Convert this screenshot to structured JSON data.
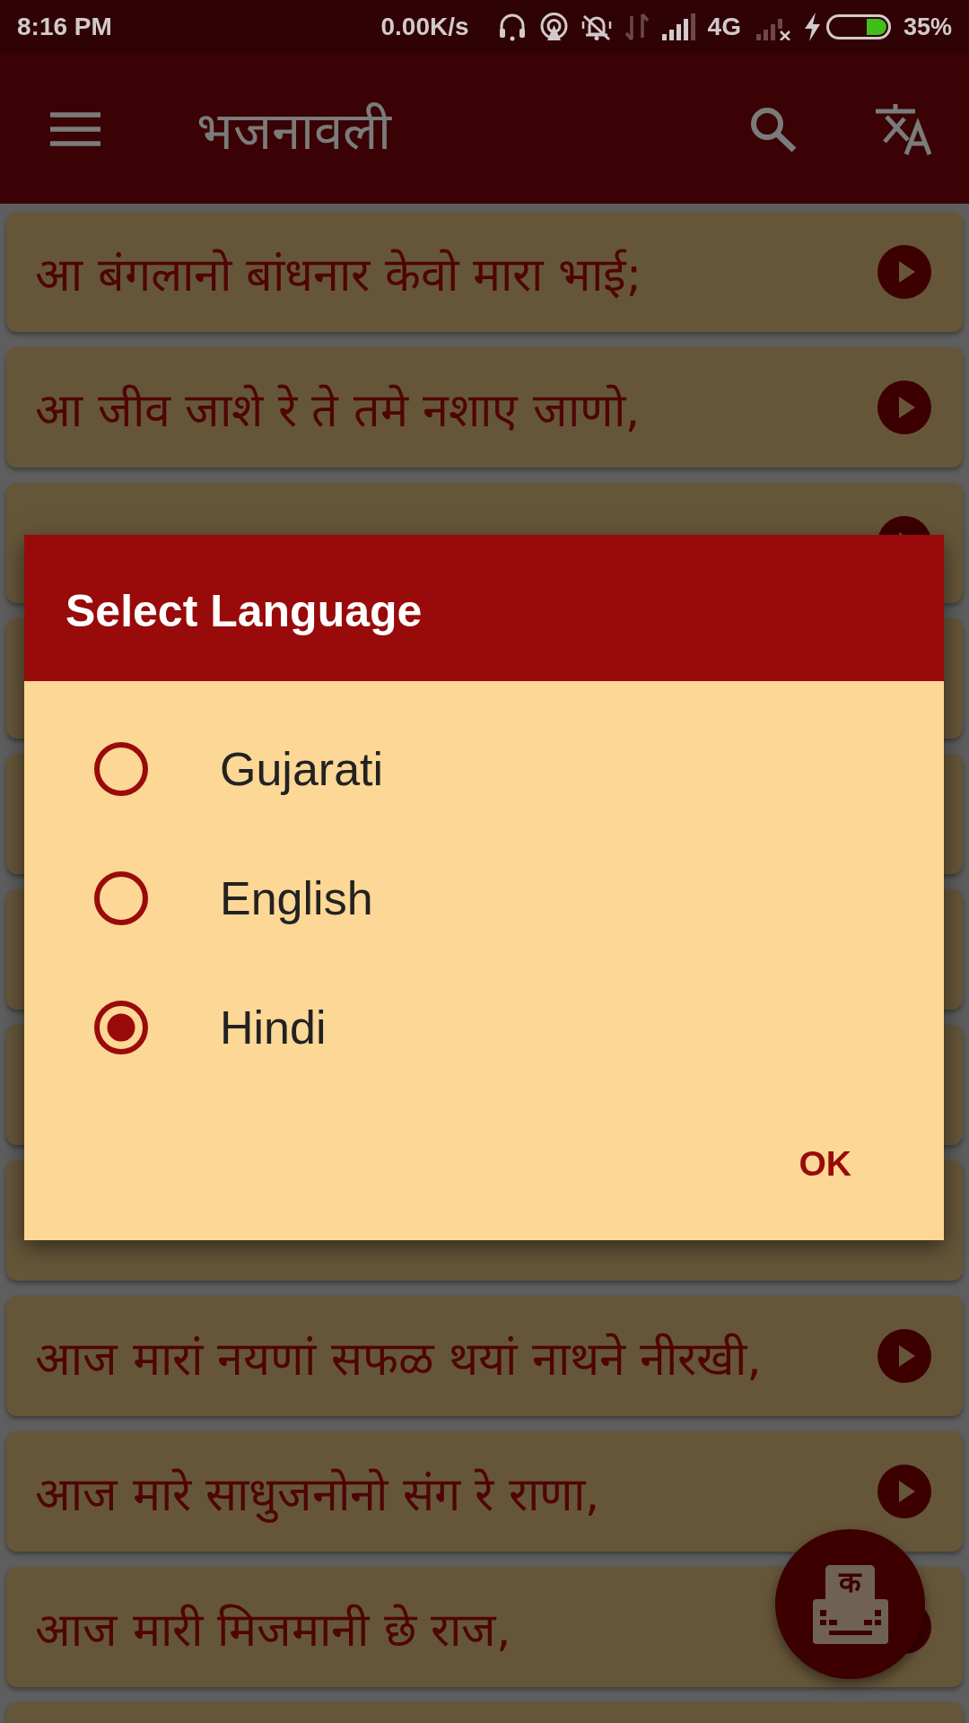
{
  "status_bar": {
    "time": "8:16 PM",
    "net_speed": "0.00K/s",
    "network_type": "4G",
    "battery": "35%"
  },
  "app_bar": {
    "title": "भजनावली"
  },
  "songs": [
    {
      "kind": "song",
      "title": "आ बंगलानो बांधनार केवो मारा भाई;"
    },
    {
      "kind": "song",
      "title": "आ जीव जाशे रे ते तमे नशाए जाणो,"
    },
    {
      "kind": "covered"
    },
    {
      "kind": "blank"
    },
    {
      "kind": "blank"
    },
    {
      "kind": "blank"
    },
    {
      "kind": "blank"
    },
    {
      "kind": "blank"
    },
    {
      "kind": "song",
      "title": "आज मारां नयणां सफळ थयां नाथने नीरखी,"
    },
    {
      "kind": "song",
      "title": "आज मारे साधुजनोनो संग रे राणा,"
    },
    {
      "kind": "song",
      "title": "आज मारी मिजमानी छे राज,"
    },
    {
      "kind": "blank"
    }
  ],
  "dialog": {
    "title": "Select Language",
    "options": [
      {
        "label": "Gujarati",
        "selected": false
      },
      {
        "label": "English",
        "selected": false
      },
      {
        "label": "Hindi",
        "selected": true
      }
    ],
    "buttons": [
      "OK"
    ]
  },
  "fab": {
    "label": "क"
  }
}
